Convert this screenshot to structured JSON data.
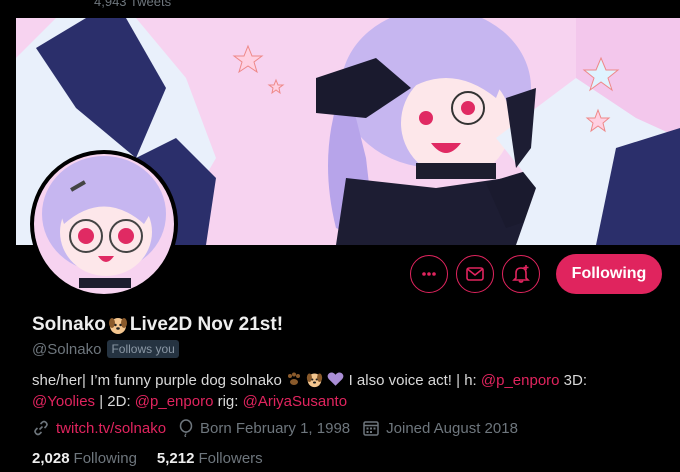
{
  "header": {
    "tweet_count": "4,943 Tweets"
  },
  "profile": {
    "name_prefix": "Solnako",
    "name_suffix": "Live2D Nov 21st!",
    "handle": "@Solnako",
    "follows_you": "Follows you",
    "bio": {
      "text1": "she/her| I’m funny purple dog solnako",
      "text2": " I also voice act! | h: ",
      "mention_h": "@p_enporo",
      "text3": " 3D:",
      "mention_3d": "@Yoolies",
      "text4": " | 2D: ",
      "mention_2d": "@p_enporo",
      "text5": " rig: ",
      "mention_rig": "@AriyaSusanto"
    },
    "website": "twitch.tv/solnako",
    "birth": "Born February 1, 1998",
    "joined": "Joined August 2018",
    "following_count": "2,028",
    "following_label": "Following",
    "followers_count": "5,212",
    "followers_label": "Followers"
  },
  "actions": {
    "more_icon": "more-icon",
    "message_icon": "mail-icon",
    "notify_icon": "bell-plus-icon",
    "follow_label": "Following"
  },
  "colors": {
    "accent": "#e0245e",
    "background": "#000000",
    "muted": "#6e767d"
  }
}
